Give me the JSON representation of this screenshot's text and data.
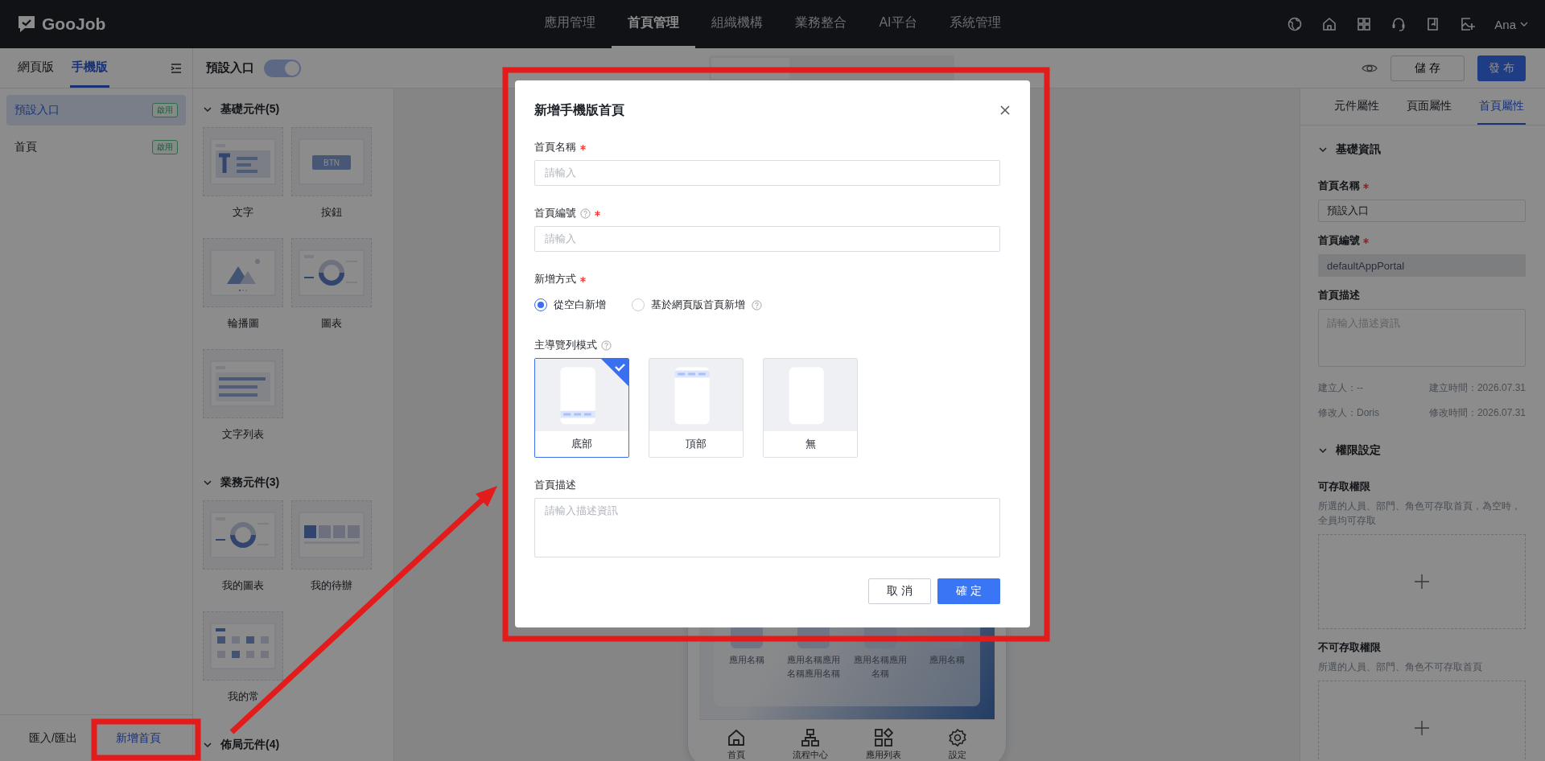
{
  "topbar": {
    "logo": "GooJob",
    "nav": [
      {
        "label": "應用管理",
        "selected": false
      },
      {
        "label": "首頁管理",
        "selected": true
      },
      {
        "label": "組織機構",
        "selected": false
      },
      {
        "label": "業務整合",
        "selected": false
      },
      {
        "label": "AI平台",
        "selected": false
      },
      {
        "label": "系統管理",
        "selected": false
      }
    ],
    "user": "Ana"
  },
  "left_panel": {
    "tabs": [
      {
        "label": "網頁版",
        "selected": false
      },
      {
        "label": "手機版",
        "selected": true
      }
    ],
    "pages": [
      {
        "name": "預設入口",
        "badge": "啟用",
        "selected": true
      },
      {
        "name": "首頁",
        "badge": "啟用",
        "selected": false
      }
    ],
    "import_export": "匯入/匯出",
    "add_page": "新增首頁"
  },
  "toolbar": {
    "title": "預設入口",
    "toggle_on": true,
    "save": "儲 存",
    "publish": "發 布"
  },
  "components": [
    {
      "title": "基礎元件(5)",
      "expanded": true,
      "button_preview_caption": "BTN",
      "items": [
        {
          "label": "文字",
          "kind": "text"
        },
        {
          "label": "按鈕",
          "kind": "button"
        },
        {
          "label": "輪播圖",
          "kind": "carousel"
        },
        {
          "label": "圖表",
          "kind": "chart"
        },
        {
          "label": "文字列表",
          "kind": "list"
        }
      ]
    },
    {
      "title": "業務元件(3)",
      "expanded": true,
      "items": [
        {
          "label": "我的圖表",
          "kind": "chart"
        },
        {
          "label": "我的待辦",
          "kind": "todo"
        },
        {
          "label": "我的常",
          "kind": "favorites"
        }
      ]
    },
    {
      "title": "佈局元件(4)",
      "expanded": true
    }
  ],
  "canvas": {
    "apps": [
      {
        "label": "應用名稱"
      },
      {
        "label": "應用名稱應用名稱應用名稱"
      },
      {
        "label": "應用名稱應用名稱"
      },
      {
        "label": "應用名稱"
      }
    ],
    "tabbar": [
      {
        "label": "首頁",
        "kind": "home"
      },
      {
        "label": "流程中心",
        "kind": "flow"
      },
      {
        "label": "應用列表",
        "kind": "apps"
      },
      {
        "label": "設定",
        "kind": "settings"
      }
    ]
  },
  "right_panel": {
    "tabs": [
      {
        "label": "元件屬性",
        "selected": false
      },
      {
        "label": "頁面屬性",
        "selected": false
      },
      {
        "label": "首頁屬性",
        "selected": true
      }
    ],
    "basic": {
      "title": "基礎資訊",
      "expanded": true,
      "fields": [
        {
          "label": "首頁名稱",
          "required": true,
          "kind": "input",
          "value": "預設入口",
          "disabled": false
        },
        {
          "label": "首頁編號",
          "required": true,
          "kind": "input",
          "value": "defaultAppPortal",
          "disabled": true
        },
        {
          "label": "首頁描述",
          "required": false,
          "kind": "textarea",
          "placeholder": "請輸入描述資訊"
        }
      ],
      "meta": [
        {
          "left": "建立人：--",
          "right": "建立時間：2026.07.31"
        },
        {
          "left": "修改人：Doris",
          "right": "修改時間：2026.07.31"
        }
      ]
    },
    "permissions": {
      "title": "權限設定",
      "expanded": true,
      "groups": [
        {
          "label": "可存取權限",
          "hint": "所選的人員、部門、角色可存取首頁，為空時，全員均可存取"
        },
        {
          "label": "不可存取權限",
          "hint": "所選的人員、部門、角色不可存取首頁"
        }
      ]
    }
  },
  "dialog": {
    "title": "新增手機版首頁",
    "fields": [
      {
        "kind": "input",
        "label": "首頁名稱",
        "required": true,
        "help": false,
        "placeholder": "請輸入"
      },
      {
        "kind": "input",
        "label": "首頁編號",
        "required": true,
        "help": true,
        "placeholder": "請輸入"
      },
      {
        "kind": "radio",
        "label": "新增方式",
        "required": true,
        "help": false,
        "options": [
          {
            "label": "從空白新增",
            "selected": true,
            "help": false
          },
          {
            "label": "基於網頁版首頁新增",
            "selected": false,
            "help": true
          }
        ]
      },
      {
        "kind": "cards",
        "label": "主導覽列模式",
        "required": false,
        "help": true,
        "options": [
          {
            "label": "底部",
            "selected": true,
            "kind": "bottom"
          },
          {
            "label": "頂部",
            "selected": false,
            "kind": "top"
          },
          {
            "label": "無",
            "selected": false,
            "kind": "none"
          }
        ]
      },
      {
        "kind": "textarea",
        "label": "首頁描述",
        "required": false,
        "help": false,
        "placeholder": "請輸入描述資訊"
      }
    ],
    "buttons": [
      {
        "label": "取 消",
        "kind": "secondary"
      },
      {
        "label": "確 定",
        "kind": "primary"
      }
    ]
  }
}
